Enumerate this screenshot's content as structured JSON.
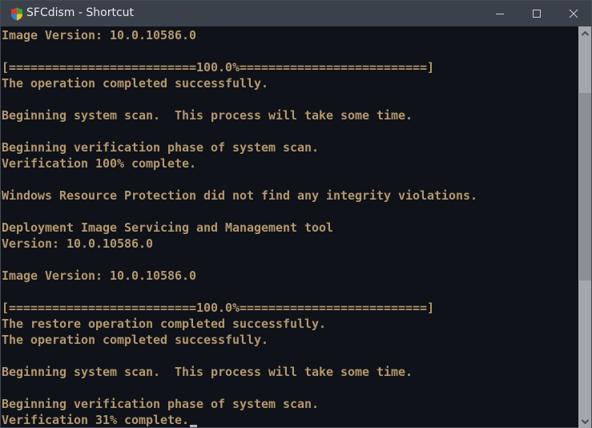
{
  "window": {
    "title": "SFCdism - Shortcut",
    "icon": "windows-shield-icon",
    "controls": {
      "minimize": "minimize-icon",
      "maximize": "maximize-icon",
      "close": "close-icon"
    }
  },
  "colors": {
    "titlebar": "#3b414b",
    "console_background": "#0f1218",
    "console_text": "#b3976f",
    "scrollbar_track": "#a4a7ac",
    "scrollbar_thumb": "#8c8f94"
  },
  "console": {
    "lines": [
      "Image Version: 10.0.10586.0",
      "",
      "[==========================100.0%==========================]",
      "The operation completed successfully.",
      "",
      "Beginning system scan.  This process will take some time.",
      "",
      "Beginning verification phase of system scan.",
      "Verification 100% complete.",
      "",
      "Windows Resource Protection did not find any integrity violations.",
      "",
      "Deployment Image Servicing and Management tool",
      "Version: 10.0.10586.0",
      "",
      "Image Version: 10.0.10586.0",
      "",
      "[==========================100.0%==========================]",
      "The restore operation completed successfully.",
      "The operation completed successfully.",
      "",
      "Beginning system scan.  This process will take some time.",
      "",
      "Beginning verification phase of system scan.",
      "Verification 31% complete."
    ]
  },
  "scrollbar": {
    "up_icon": "chevron-up-icon",
    "down_icon": "chevron-down-icon",
    "position_fraction": 0.2,
    "visible_fraction": 0.5
  }
}
